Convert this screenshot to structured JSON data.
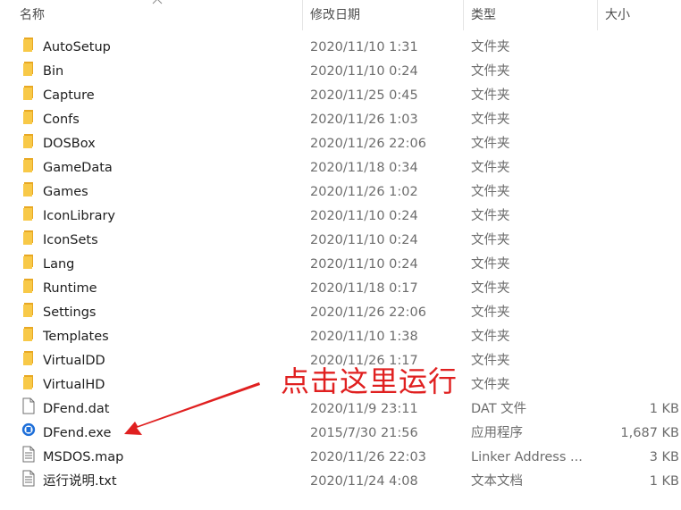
{
  "header": {
    "name": "名称",
    "date": "修改日期",
    "type": "类型",
    "size": "大小"
  },
  "files": [
    {
      "name": "AutoSetup",
      "date": "2020/11/10 1:31",
      "type": "文件夹",
      "size": "",
      "icon": "folder-icon"
    },
    {
      "name": "Bin",
      "date": "2020/11/10 0:24",
      "type": "文件夹",
      "size": "",
      "icon": "folder-icon"
    },
    {
      "name": "Capture",
      "date": "2020/11/25 0:45",
      "type": "文件夹",
      "size": "",
      "icon": "folder-icon"
    },
    {
      "name": "Confs",
      "date": "2020/11/26 1:03",
      "type": "文件夹",
      "size": "",
      "icon": "folder-icon"
    },
    {
      "name": "DOSBox",
      "date": "2020/11/26 22:06",
      "type": "文件夹",
      "size": "",
      "icon": "folder-icon"
    },
    {
      "name": "GameData",
      "date": "2020/11/18 0:34",
      "type": "文件夹",
      "size": "",
      "icon": "folder-icon"
    },
    {
      "name": "Games",
      "date": "2020/11/26 1:02",
      "type": "文件夹",
      "size": "",
      "icon": "folder-icon"
    },
    {
      "name": "IconLibrary",
      "date": "2020/11/10 0:24",
      "type": "文件夹",
      "size": "",
      "icon": "folder-icon"
    },
    {
      "name": "IconSets",
      "date": "2020/11/10 0:24",
      "type": "文件夹",
      "size": "",
      "icon": "folder-icon"
    },
    {
      "name": "Lang",
      "date": "2020/11/10 0:24",
      "type": "文件夹",
      "size": "",
      "icon": "folder-icon"
    },
    {
      "name": "Runtime",
      "date": "2020/11/18 0:17",
      "type": "文件夹",
      "size": "",
      "icon": "folder-icon"
    },
    {
      "name": "Settings",
      "date": "2020/11/26 22:06",
      "type": "文件夹",
      "size": "",
      "icon": "folder-icon"
    },
    {
      "name": "Templates",
      "date": "2020/11/10 1:38",
      "type": "文件夹",
      "size": "",
      "icon": "folder-icon"
    },
    {
      "name": "VirtualDD",
      "date": "2020/11/26 1:17",
      "type": "文件夹",
      "size": "",
      "icon": "folder-icon"
    },
    {
      "name": "VirtualHD",
      "date": "",
      "type": "文件夹",
      "size": "",
      "icon": "folder-icon"
    },
    {
      "name": "DFend.dat",
      "date": "2020/11/9 23:11",
      "type": "DAT 文件",
      "size": "1 KB",
      "icon": "blank-file-icon"
    },
    {
      "name": "DFend.exe",
      "date": "2015/7/30 21:56",
      "type": "应用程序",
      "size": "1,687 KB",
      "icon": "app-icon"
    },
    {
      "name": "MSDOS.map",
      "date": "2020/11/26 22:03",
      "type": "Linker Address ...",
      "size": "3 KB",
      "icon": "text-file-icon"
    },
    {
      "name": "运行说明.txt",
      "date": "2020/11/24 4:08",
      "type": "文本文档",
      "size": "1 KB",
      "icon": "text-file-icon"
    }
  ],
  "annotation": {
    "text": "点击这里运行",
    "color": "#e02020"
  },
  "colors": {
    "folder": "#f8c948",
    "folder_dark": "#e8a823",
    "app": "#1e6fd9"
  }
}
